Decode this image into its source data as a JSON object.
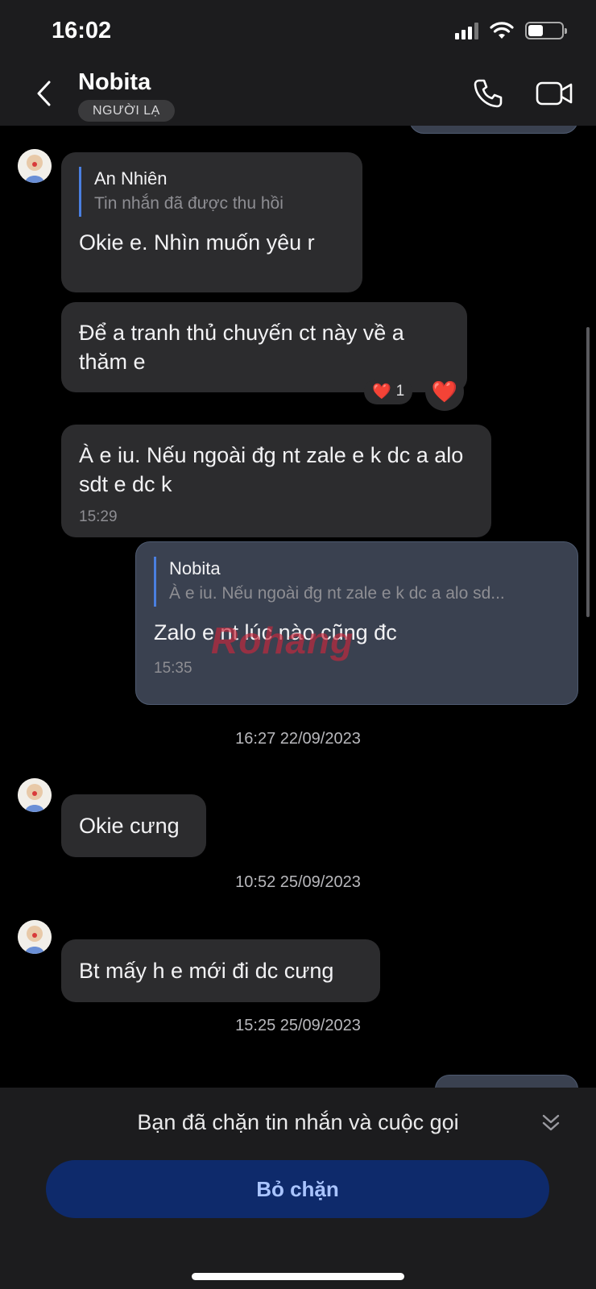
{
  "status_bar": {
    "time": "16:02",
    "battery_level": 0.45
  },
  "header": {
    "contact_name": "Nobita",
    "badge": "NGƯỜI LẠ"
  },
  "messages": [
    {
      "direction": "in",
      "quote": {
        "name": "An Nhiên",
        "text": "Tin nhắn đã được thu hồi"
      },
      "text": "Okie e. Nhìn muốn yêu r"
    },
    {
      "direction": "in",
      "text": "Để a tranh thủ chuyến ct này về a thăm e",
      "reaction": {
        "emoji": "❤️",
        "count": "1"
      }
    },
    {
      "direction": "in",
      "text": "À e iu. Nếu ngoài đg nt zale e k dc a alo sdt e dc k",
      "time": "15:29"
    },
    {
      "direction": "out",
      "quote": {
        "name": "Nobita",
        "text": "À e iu. Nếu ngoài đg nt zale e k dc a alo sd..."
      },
      "text": "Zalo e nt lúc nào cũng đc",
      "time": "15:35"
    },
    {
      "direction": "in",
      "text": "Okie cưng"
    },
    {
      "direction": "in",
      "text": "Bt mấy h e mới đi dc cưng"
    }
  ],
  "date_separators": [
    "16:27 22/09/2023",
    "10:52 25/09/2023",
    "15:25 25/09/2023"
  ],
  "react_button_emoji": "❤️",
  "watermark": "Rohang",
  "bottom": {
    "blocked_notice": "Bạn đã chặn tin nhắn và cuộc gọi",
    "unblock_label": "Bỏ chặn"
  },
  "colors": {
    "accent_quote_bar": "#4a7fe0",
    "unblock_button": "#0e2a6b",
    "unblock_text": "#a9c4ff",
    "outgoing_bubble": "#3a4150"
  },
  "icons": [
    "back-chevron",
    "phone",
    "video-camera",
    "heart",
    "double-chevron-down"
  ]
}
